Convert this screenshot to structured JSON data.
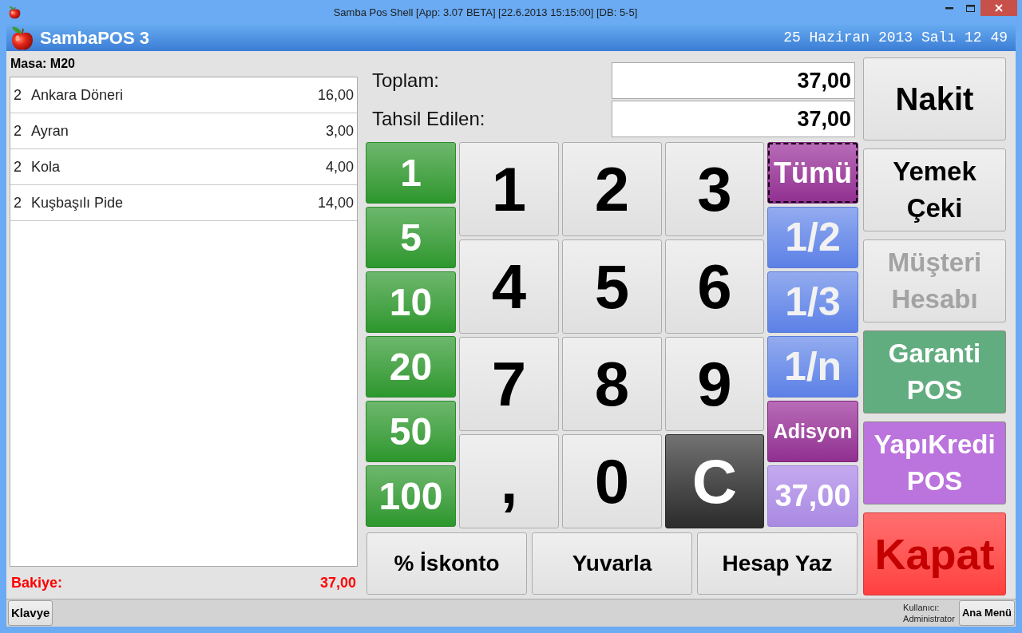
{
  "window": {
    "title": "Samba Pos Shell [App: 3.07 BETA] [22.6.2013 15:15:00] [DB: 5-5]"
  },
  "header": {
    "app_name": "SambaPOS 3",
    "datetime": "25 Haziran 2013 Salı 12 49"
  },
  "ticket": {
    "label": "Masa: M20",
    "items": [
      {
        "quantity": "2",
        "name": "Ankara Döneri",
        "price": "16,00"
      },
      {
        "quantity": "2",
        "name": "Ayran",
        "price": "3,00"
      },
      {
        "quantity": "2",
        "name": "Kola",
        "price": "4,00"
      },
      {
        "quantity": "2",
        "name": "Kuşbaşılı Pide",
        "price": "14,00"
      }
    ],
    "balance_label": "Bakiye:",
    "balance": "37,00"
  },
  "totals": [
    {
      "label": "Toplam:",
      "value": "37,00"
    },
    {
      "label": "Tahsil Edilen:",
      "value": "37,00"
    }
  ],
  "amount_buttons": [
    "1",
    "5",
    "10",
    "20",
    "50",
    "100"
  ],
  "numpad": [
    {
      "label": "1",
      "kind": "key"
    },
    {
      "label": "2",
      "kind": "key"
    },
    {
      "label": "3",
      "kind": "key"
    },
    {
      "label": "4",
      "kind": "key"
    },
    {
      "label": "5",
      "kind": "key"
    },
    {
      "label": "6",
      "kind": "key"
    },
    {
      "label": "7",
      "kind": "key"
    },
    {
      "label": "8",
      "kind": "key"
    },
    {
      "label": "9",
      "kind": "key"
    },
    {
      "label": ",",
      "kind": "key"
    },
    {
      "label": "0",
      "kind": "key"
    },
    {
      "label": "C",
      "kind": "clear"
    }
  ],
  "split_buttons": [
    {
      "label": "Tümü",
      "kind": "all",
      "focused": true
    },
    {
      "label": "1/2",
      "kind": "fraction",
      "focused": false
    },
    {
      "label": "1/3",
      "kind": "fraction",
      "focused": false
    },
    {
      "label": "1/n",
      "kind": "fraction",
      "focused": false
    },
    {
      "label": "Adisyon",
      "kind": "ticket",
      "focused": false
    },
    {
      "label": "37,00",
      "kind": "remaining",
      "focused": false
    }
  ],
  "action_buttons": [
    "% İskonto",
    "Yuvarla",
    "Hesap Yaz"
  ],
  "payment_buttons": [
    {
      "label": "Nakit",
      "kind": "plain",
      "disabled": false
    },
    {
      "label": "Yemek Çeki",
      "kind": "plain",
      "disabled": false
    },
    {
      "label": "Müşteri Hesabı",
      "kind": "plain",
      "disabled": true
    },
    {
      "label": "Garanti POS",
      "kind": "bank",
      "color": "#62ad80",
      "disabled": false
    },
    {
      "label": "YapıKredi POS",
      "kind": "bank",
      "color": "#bb73dd",
      "disabled": false
    },
    {
      "label": "Kapat",
      "kind": "close",
      "disabled": false
    }
  ],
  "status_bar": {
    "keyboard_button": "Klavye",
    "user_label": "Kullanıcı:",
    "user_name": "Administrator",
    "menu_button": "Ana Menü"
  }
}
